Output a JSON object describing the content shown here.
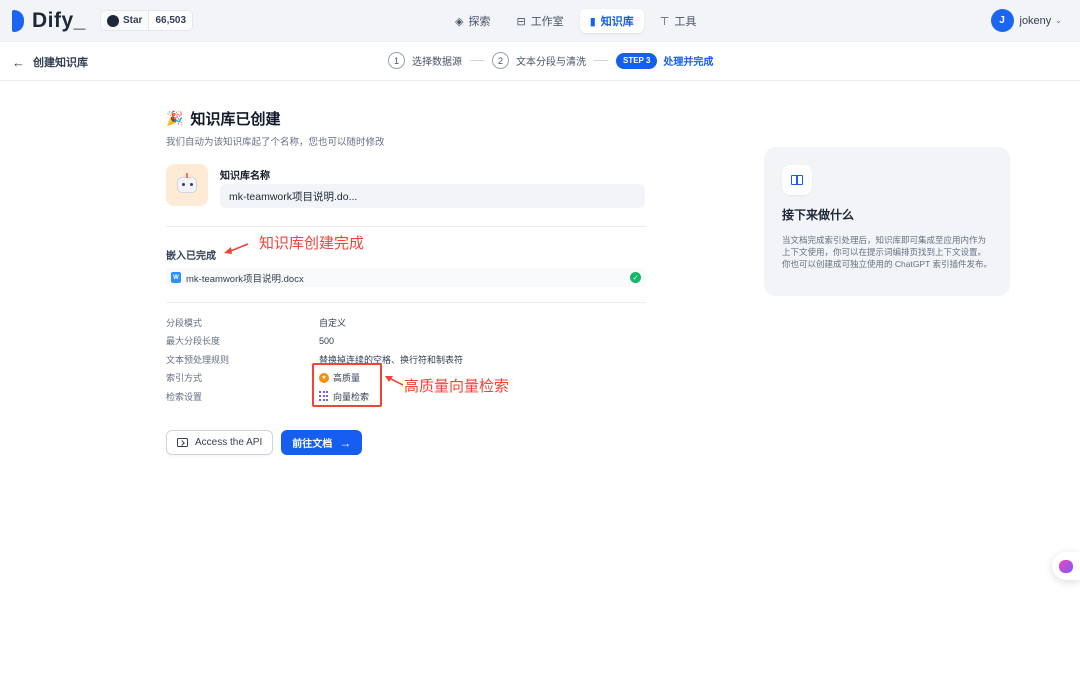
{
  "app": {
    "logo_text": "Dify_",
    "github": {
      "star_label": "Star",
      "star_count": "66,503"
    },
    "nav": [
      {
        "label": "探索",
        "icon": "compass-icon"
      },
      {
        "label": "工作室",
        "icon": "robot-icon"
      },
      {
        "label": "知识库",
        "icon": "book-icon",
        "active": true
      },
      {
        "label": "工具",
        "icon": "hammer-icon"
      }
    ],
    "user": {
      "initial": "J",
      "name": "jokeny"
    }
  },
  "stepbar": {
    "back_label": "创建知识库",
    "steps": [
      {
        "num": "1",
        "label": "选择数据源"
      },
      {
        "num": "2",
        "label": "文本分段与清洗"
      },
      {
        "num": "STEP 3",
        "label": "处理并完成",
        "active": true
      }
    ]
  },
  "main": {
    "title": "知识库已创建",
    "subtitle": "我们自动为该知识库起了个名称，您也可以随时修改",
    "name_label": "知识库名称",
    "name_value": "mk-teamwork项目说明.do...",
    "embed_title": "嵌入已完成",
    "file_name": "mk-teamwork项目说明.docx",
    "info": [
      {
        "key": "分段模式",
        "value": "自定义"
      },
      {
        "key": "最大分段长度",
        "value": "500"
      },
      {
        "key": "文本预处理规则",
        "value": "替换掉连续的空格、换行符和制表符"
      },
      {
        "key": "索引方式",
        "value": "高质量"
      },
      {
        "key": "检索设置",
        "value": "向量检索"
      }
    ],
    "api_button": "Access the API",
    "doc_button": "前往文档"
  },
  "annotations": {
    "kb_created": "知识库创建完成",
    "hq_vector": "高质量向量检索"
  },
  "next_card": {
    "title": "接下来做什么",
    "description": "当文档完成索引处理后，知识库即可集成至应用内作为上下文使用，你可以在提示词编排页找到上下文设置。你也可以创建成可独立使用的 ChatGPT 索引插件发布。"
  },
  "colors": {
    "accent": "#155eef",
    "annotation": "#f04438",
    "success": "#12b76a"
  }
}
